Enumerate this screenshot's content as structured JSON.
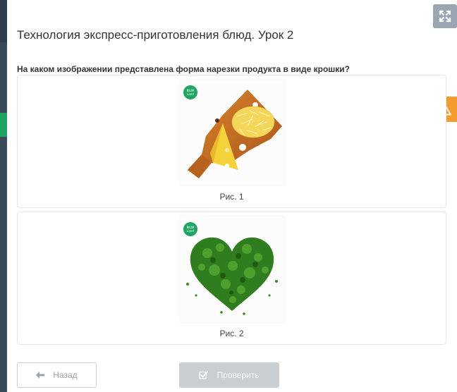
{
  "page": {
    "title": "Технология экспресс-приготовления блюд. Урок 2",
    "question": "На каком изображении представлена форма нарезки продукта в виде крошки?"
  },
  "options": [
    {
      "caption": "Рис. 1",
      "image": "cheese-on-board",
      "logo_top": "BILIM",
      "logo_bottom": "Land"
    },
    {
      "caption": "Рис. 2",
      "image": "parsley-heart",
      "logo_top": "BILIM",
      "logo_bottom": "Land"
    }
  ],
  "buttons": {
    "back_label": "Назад",
    "back_icon": "arrow-left-icon",
    "check_label": "Проверить",
    "check_icon": "check-square-icon",
    "expand_icon": "expand-icon",
    "warning_icon": "warning-icon"
  },
  "colors": {
    "accent_green": "#1fa463",
    "warning_orange": "#f39c2d",
    "disabled_button": "#c9ced3",
    "expand_button": "#9aa7b3"
  }
}
